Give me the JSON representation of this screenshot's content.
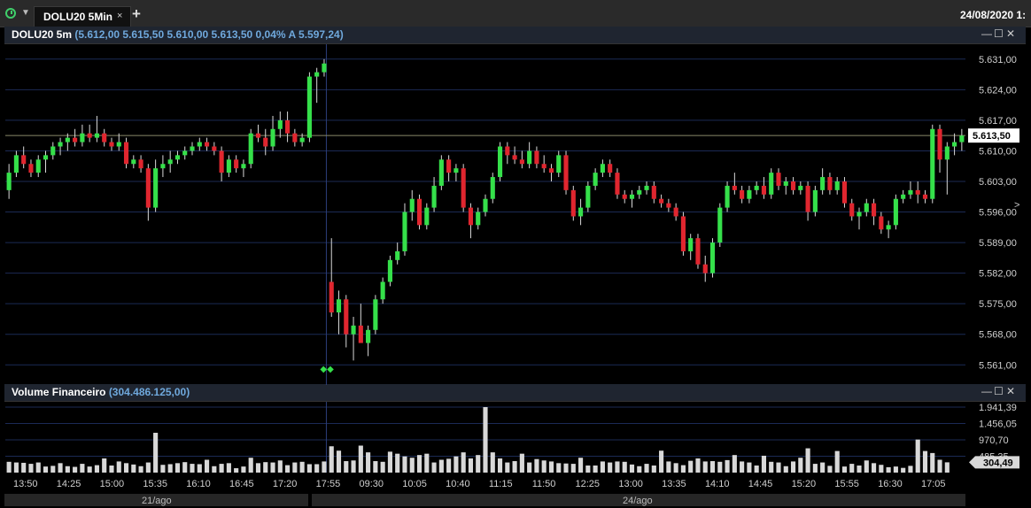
{
  "topbar": {
    "clock_icon": "clock-icon",
    "tab_label": "DOLU20 5Min",
    "close_glyph": "×",
    "add_glyph": "+",
    "datetime": "24/08/2020 1:"
  },
  "main_panel": {
    "symbol": "DOLU20 5m",
    "quote": "(5.612,00  5.615,50  5.610,00  5.613,50  0,04%  A 5.597,24)",
    "last_price_label": "5.613,50",
    "last_price": 5613.5,
    "price_ticks": [
      "5.631,00",
      "5.624,00",
      "5.617,00",
      "5.610,00",
      "5.603,00",
      "5.596,00",
      "5.589,00",
      "5.582,00",
      "5.575,00",
      "5.568,00",
      "5.561,00"
    ]
  },
  "volume_panel": {
    "title": "Volume Financeiro",
    "value": "(304.486.125,00)",
    "ticks": [
      "1.941,39",
      "1.456,05",
      "970,70",
      "485,35"
    ],
    "last_label": "304,49"
  },
  "time_axis": {
    "labels": [
      "13:50",
      "14:25",
      "15:00",
      "15:35",
      "16:10",
      "16:45",
      "17:20",
      "17:55",
      "09:30",
      "10:05",
      "10:40",
      "11:15",
      "11:50",
      "12:25",
      "13:00",
      "13:35",
      "14:10",
      "14:45",
      "15:20",
      "15:55",
      "16:30",
      "17:05"
    ],
    "days": [
      "21/ago",
      "24/ago"
    ]
  },
  "colors": {
    "up": "#35e04a",
    "down": "#e0262f",
    "grid": "#1b2a55",
    "volume": "#d8d8d8"
  },
  "chart_data": {
    "type": "candlestick",
    "ohlc": [
      [
        5601,
        5607,
        5599,
        5605
      ],
      [
        5605,
        5610,
        5604,
        5609
      ],
      [
        5609,
        5611,
        5606,
        5607
      ],
      [
        5607,
        5608,
        5604,
        5605
      ],
      [
        5605,
        5609,
        5604,
        5608
      ],
      [
        5608,
        5610,
        5605,
        5609
      ],
      [
        5609,
        5612,
        5608,
        5611
      ],
      [
        5611,
        5613,
        5609,
        5612
      ],
      [
        5612,
        5614,
        5610,
        5613
      ],
      [
        5613,
        5615,
        5611,
        5612
      ],
      [
        5612,
        5616,
        5611,
        5614
      ],
      [
        5614,
        5616,
        5612,
        5613
      ],
      [
        5613,
        5618,
        5612,
        5614
      ],
      [
        5614,
        5615,
        5611,
        5612
      ],
      [
        5612,
        5613,
        5610,
        5611
      ],
      [
        5611,
        5614,
        5610,
        5612
      ],
      [
        5612,
        5613,
        5606,
        5607
      ],
      [
        5607,
        5609,
        5606,
        5608
      ],
      [
        5608,
        5609,
        5605,
        5606
      ],
      [
        5606,
        5607,
        5594,
        5597
      ],
      [
        5597,
        5608,
        5596,
        5606
      ],
      [
        5606,
        5609,
        5604,
        5607
      ],
      [
        5607,
        5610,
        5605,
        5608
      ],
      [
        5608,
        5610,
        5607,
        5609
      ],
      [
        5609,
        5611,
        5608,
        5610
      ],
      [
        5610,
        5612,
        5609,
        5611
      ],
      [
        5611,
        5613,
        5610,
        5612
      ],
      [
        5612,
        5613,
        5610,
        5611
      ],
      [
        5611,
        5612,
        5609,
        5610
      ],
      [
        5610,
        5611,
        5603,
        5605
      ],
      [
        5605,
        5609,
        5604,
        5608
      ],
      [
        5608,
        5609,
        5605,
        5606
      ],
      [
        5606,
        5608,
        5604,
        5607
      ],
      [
        5607,
        5615,
        5606,
        5614
      ],
      [
        5614,
        5616,
        5612,
        5613
      ],
      [
        5613,
        5615,
        5609,
        5611
      ],
      [
        5611,
        5618,
        5610,
        5615
      ],
      [
        5615,
        5619,
        5613,
        5617
      ],
      [
        5617,
        5619,
        5612,
        5614
      ],
      [
        5614,
        5615,
        5611,
        5612
      ],
      [
        5612,
        5614,
        5611,
        5613
      ],
      [
        5613,
        5628,
        5612,
        5627
      ],
      [
        5627,
        5629,
        5621,
        5628
      ],
      [
        5628,
        5631,
        5627,
        5630
      ],
      [
        5580,
        5590,
        5572,
        5573
      ],
      [
        5573,
        5578,
        5568,
        5576
      ],
      [
        5576,
        5577,
        5565,
        5568
      ],
      [
        5568,
        5572,
        5562,
        5570
      ],
      [
        5570,
        5575,
        5567,
        5566
      ],
      [
        5566,
        5570,
        5563,
        5569
      ],
      [
        5569,
        5577,
        5568,
        5576
      ],
      [
        5576,
        5581,
        5575,
        5580
      ],
      [
        5580,
        5586,
        5579,
        5585
      ],
      [
        5585,
        5589,
        5584,
        5587
      ],
      [
        5587,
        5598,
        5586,
        5596
      ],
      [
        5596,
        5601,
        5594,
        5599
      ],
      [
        5599,
        5600,
        5592,
        5593
      ],
      [
        5593,
        5598,
        5592,
        5597
      ],
      [
        5597,
        5604,
        5596,
        5602
      ],
      [
        5602,
        5609,
        5601,
        5608
      ],
      [
        5608,
        5609,
        5603,
        5605
      ],
      [
        5605,
        5607,
        5603,
        5606
      ],
      [
        5606,
        5607,
        5596,
        5597
      ],
      [
        5597,
        5598,
        5590,
        5593
      ],
      [
        5593,
        5597,
        5592,
        5596
      ],
      [
        5596,
        5600,
        5595,
        5599
      ],
      [
        5599,
        5605,
        5598,
        5604
      ],
      [
        5604,
        5612,
        5603,
        5611
      ],
      [
        5611,
        5612,
        5607,
        5609
      ],
      [
        5609,
        5611,
        5607,
        5608
      ],
      [
        5608,
        5610,
        5606,
        5607
      ],
      [
        5607,
        5612,
        5606,
        5610
      ],
      [
        5610,
        5611,
        5606,
        5607
      ],
      [
        5607,
        5609,
        5605,
        5606
      ],
      [
        5606,
        5607,
        5603,
        5605
      ],
      [
        5605,
        5610,
        5604,
        5609
      ],
      [
        5609,
        5610,
        5600,
        5601
      ],
      [
        5601,
        5602,
        5594,
        5595
      ],
      [
        5595,
        5599,
        5593,
        5597
      ],
      [
        5597,
        5603,
        5596,
        5602
      ],
      [
        5602,
        5606,
        5601,
        5605
      ],
      [
        5605,
        5608,
        5604,
        5607
      ],
      [
        5607,
        5608,
        5604,
        5605
      ],
      [
        5605,
        5606,
        5599,
        5600
      ],
      [
        5600,
        5601,
        5598,
        5599
      ],
      [
        5599,
        5601,
        5597,
        5600
      ],
      [
        5600,
        5602,
        5599,
        5601
      ],
      [
        5601,
        5603,
        5600,
        5602
      ],
      [
        5602,
        5603,
        5598,
        5599
      ],
      [
        5599,
        5600,
        5597,
        5598
      ],
      [
        5598,
        5599,
        5596,
        5597
      ],
      [
        5597,
        5598,
        5594,
        5595
      ],
      [
        5595,
        5596,
        5586,
        5587
      ],
      [
        5587,
        5591,
        5585,
        5590
      ],
      [
        5590,
        5591,
        5583,
        5584
      ],
      [
        5584,
        5586,
        5580,
        5582
      ],
      [
        5582,
        5590,
        5581,
        5589
      ],
      [
        5589,
        5598,
        5588,
        5597
      ],
      [
        5597,
        5603,
        5596,
        5602
      ],
      [
        5602,
        5605,
        5600,
        5601
      ],
      [
        5601,
        5602,
        5598,
        5599
      ],
      [
        5599,
        5602,
        5598,
        5601
      ],
      [
        5601,
        5603,
        5600,
        5602
      ],
      [
        5602,
        5604,
        5599,
        5600
      ],
      [
        5600,
        5606,
        5599,
        5605
      ],
      [
        5605,
        5606,
        5601,
        5602
      ],
      [
        5602,
        5604,
        5600,
        5603
      ],
      [
        5603,
        5604,
        5600,
        5601
      ],
      [
        5601,
        5603,
        5600,
        5602
      ],
      [
        5602,
        5603,
        5594,
        5596
      ],
      [
        5596,
        5602,
        5595,
        5601
      ],
      [
        5601,
        5606,
        5600,
        5604
      ],
      [
        5604,
        5605,
        5600,
        5601
      ],
      [
        5601,
        5604,
        5600,
        5603
      ],
      [
        5603,
        5604,
        5597,
        5598
      ],
      [
        5598,
        5599,
        5594,
        5595
      ],
      [
        5595,
        5597,
        5592,
        5596
      ],
      [
        5596,
        5599,
        5595,
        5598
      ],
      [
        5598,
        5599,
        5593,
        5595
      ],
      [
        5595,
        5596,
        5591,
        5592
      ],
      [
        5592,
        5594,
        5590,
        5593
      ],
      [
        5593,
        5600,
        5592,
        5599
      ],
      [
        5599,
        5601,
        5598,
        5600
      ],
      [
        5600,
        5603,
        5599,
        5601
      ],
      [
        5601,
        5603,
        5598,
        5600
      ],
      [
        5600,
        5601,
        5598,
        5599
      ],
      [
        5599,
        5616,
        5598,
        5615
      ],
      [
        5615,
        5616,
        5605,
        5608
      ],
      [
        5608,
        5612,
        5600,
        5611
      ],
      [
        5611,
        5614,
        5609,
        5612
      ],
      [
        5612,
        5615,
        5610,
        5613.5
      ]
    ],
    "volume": [
      320,
      300,
      290,
      260,
      300,
      180,
      200,
      280,
      190,
      170,
      260,
      180,
      220,
      420,
      210,
      330,
      280,
      240,
      190,
      300,
      1180,
      230,
      250,
      280,
      310,
      260,
      250,
      380,
      190,
      260,
      280,
      130,
      180,
      440,
      280,
      310,
      300,
      360,
      220,
      300,
      320,
      250,
      250,
      330,
      780,
      650,
      340,
      360,
      800,
      600,
      340,
      320,
      620,
      560,
      480,
      440,
      520,
      560,
      300,
      380,
      410,
      480,
      600,
      420,
      520,
      1941,
      600,
      420,
      300,
      340,
      560,
      300,
      400,
      360,
      330,
      280,
      270,
      260,
      440,
      210,
      210,
      330,
      300,
      330,
      320,
      240,
      190,
      260,
      210,
      650,
      330,
      280,
      220,
      350,
      420,
      330,
      340,
      320,
      370,
      520,
      330,
      300,
      210,
      500,
      320,
      300,
      190,
      330,
      440,
      720,
      260,
      300,
      200,
      640,
      180,
      260,
      210,
      360,
      280,
      230,
      160,
      180,
      140,
      200,
      980,
      640,
      580,
      380,
      304.49
    ],
    "ylim": [
      5557,
      5634
    ]
  }
}
